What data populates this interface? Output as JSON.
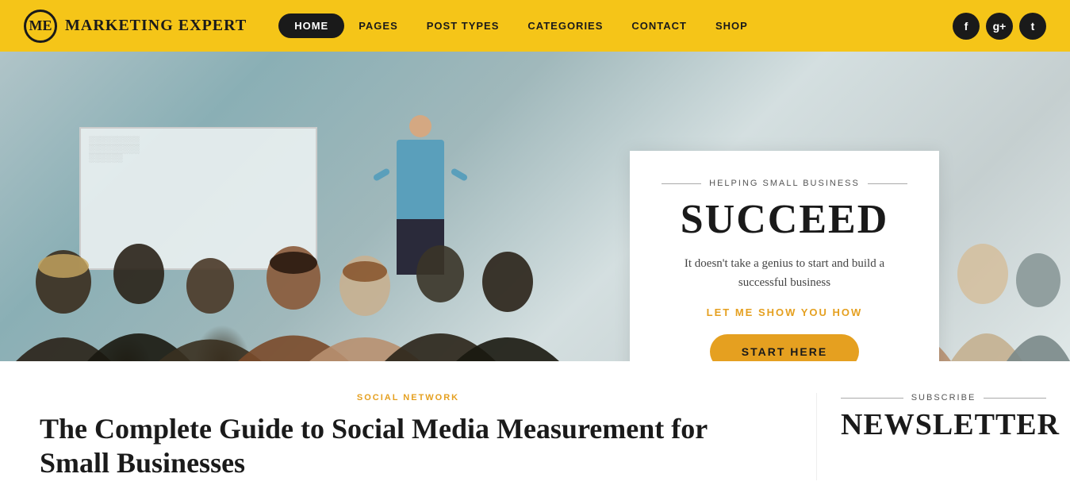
{
  "header": {
    "logo_initials": "ME",
    "logo_name": "MARKETING EXPERT",
    "nav": [
      {
        "id": "home",
        "label": "HOME",
        "active": true
      },
      {
        "id": "pages",
        "label": "PAGES",
        "active": false
      },
      {
        "id": "post-types",
        "label": "POST TYPES",
        "active": false
      },
      {
        "id": "categories",
        "label": "CATEGORIES",
        "active": false
      },
      {
        "id": "contact",
        "label": "CONTACT",
        "active": false
      },
      {
        "id": "shop",
        "label": "SHOP",
        "active": false
      }
    ],
    "social": [
      {
        "id": "facebook",
        "icon": "f"
      },
      {
        "id": "googleplus",
        "icon": "g+"
      },
      {
        "id": "twitter",
        "icon": "t"
      }
    ]
  },
  "hero": {
    "tagline": "HELPING SMALL BUSINESS",
    "title": "SUCCEED",
    "description": "It doesn't take a genius to start and build a successful business",
    "cta_link": "LET ME SHOW YOU HOW",
    "cta_button": "START HERE"
  },
  "content": {
    "category": "SOCIAL NETWORK",
    "article_title": "The Complete Guide to Social Media Measurement for Small Businesses"
  },
  "sidebar": {
    "subscribe_label": "SUBSCRIBE",
    "newsletter_title": "NEWSLETTER"
  }
}
